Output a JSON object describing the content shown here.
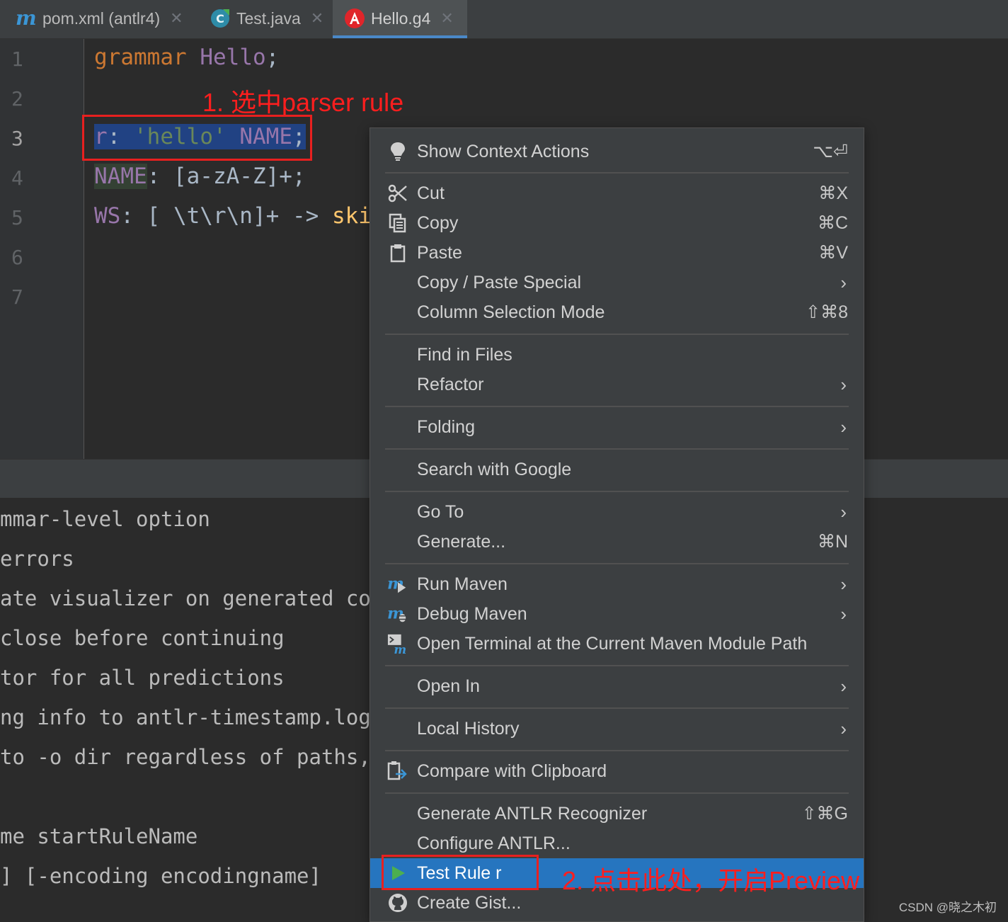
{
  "tabs": [
    {
      "label": "pom.xml (antlr4)",
      "icon": "maven-icon",
      "active": false
    },
    {
      "label": "Test.java",
      "icon": "java-class-icon",
      "active": false
    },
    {
      "label": "Hello.g4",
      "icon": "antlr-icon",
      "active": true
    }
  ],
  "editor": {
    "line_numbers": [
      "1",
      "2",
      "3",
      "4",
      "5",
      "6",
      "7"
    ],
    "current_line": 3,
    "lines": {
      "l1_kw": "grammar",
      "l1_name": "Hello",
      "l1_end": ";",
      "l3_rule": "r",
      "l3_colon": ":",
      "l3_str": "'hello'",
      "l3_name": "NAME",
      "l3_end": ";",
      "l4_name": "NAME",
      "l4_rest": ": [a-zA-Z]+;",
      "l5_name": "WS",
      "l5_rest": ": [ \\t\\r\\n]+ -> ",
      "l5_skip": "skip"
    }
  },
  "console": {
    "lines": [
      "mmar-level option",
      "errors",
      "ate visualizer on generated co",
      "close before continuing",
      "tor for all predictions",
      "ng info to antlr-timestamp.log",
      "to -o dir regardless of paths,",
      "",
      "me startRuleName",
      "] [-encoding encodingname]"
    ]
  },
  "annotations": {
    "step1": "1. 选中parser rule",
    "step2": "2. 点击此处，开启Preview"
  },
  "context_menu": {
    "items": [
      {
        "label": "Show Context Actions",
        "shortcut": "⌥⏎",
        "icon": "lightbulb-icon"
      },
      {
        "label": "Cut",
        "shortcut": "⌘X",
        "icon": "scissors-icon"
      },
      {
        "label": "Copy",
        "shortcut": "⌘C",
        "icon": "copy-icon"
      },
      {
        "label": "Paste",
        "shortcut": "⌘V",
        "icon": "paste-icon"
      },
      {
        "label": "Copy / Paste Special",
        "submenu": true
      },
      {
        "label": "Column Selection Mode",
        "shortcut": "⇧⌘8"
      },
      {
        "label": "Find in Files"
      },
      {
        "label": "Refactor",
        "submenu": true
      },
      {
        "label": "Folding",
        "submenu": true
      },
      {
        "label": "Search with Google"
      },
      {
        "label": "Go To",
        "submenu": true
      },
      {
        "label": "Generate...",
        "shortcut": "⌘N"
      },
      {
        "label": "Run Maven",
        "submenu": true,
        "icon": "maven-run-icon"
      },
      {
        "label": "Debug Maven",
        "submenu": true,
        "icon": "maven-debug-icon"
      },
      {
        "label": "Open Terminal at the Current Maven Module Path",
        "icon": "maven-terminal-icon"
      },
      {
        "label": "Open In",
        "submenu": true
      },
      {
        "label": "Local History",
        "submenu": true
      },
      {
        "label": "Compare with Clipboard",
        "icon": "compare-clipboard-icon"
      },
      {
        "label": "Generate ANTLR Recognizer",
        "shortcut": "⇧⌘G"
      },
      {
        "label": "Configure ANTLR..."
      },
      {
        "label": "Test Rule r",
        "icon": "play-icon",
        "highlighted": true
      },
      {
        "label": "Create Gist...",
        "icon": "github-icon"
      }
    ],
    "arrow_glyph": "›"
  },
  "watermark": "CSDN @晓之木初",
  "colors": {
    "accent": "#2675bf",
    "annotation_red": "#ff1e1e",
    "keyword": "#cc7832",
    "rule": "#9876aa",
    "string": "#6a8759"
  }
}
